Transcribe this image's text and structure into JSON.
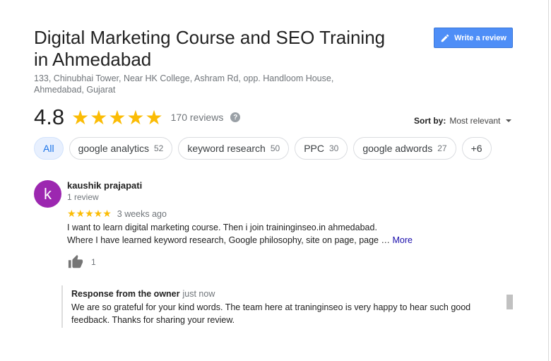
{
  "place": {
    "title": "Digital Marketing Course and SEO Training in Ahmedabad",
    "address": "133, Chinubhai Tower, Near HK College, Ashram Rd, opp. Handloom House, Ahmedabad, Gujarat"
  },
  "actions": {
    "write_review": "Write a review"
  },
  "rating": {
    "value": "4.8",
    "stars": "★★★★★",
    "count_text": "170 reviews",
    "help": "?"
  },
  "sort": {
    "label": "Sort by:",
    "value": "Most relevant"
  },
  "chips": [
    {
      "label": "All",
      "count": ""
    },
    {
      "label": "google analytics",
      "count": "52"
    },
    {
      "label": "keyword research",
      "count": "50"
    },
    {
      "label": "PPC",
      "count": "30"
    },
    {
      "label": "google adwords",
      "count": "27"
    },
    {
      "label": "+6",
      "count": ""
    }
  ],
  "review": {
    "avatar_letter": "k",
    "name": "kaushik prajapati",
    "review_count": "1 review",
    "stars": "★★★★★",
    "time": "3 weeks ago",
    "line1": "I want to learn digital marketing course. Then i join traininginseo.in ahmedabad.",
    "line2": "Where I have learned keyword research, Google philosophy, site on page, page …",
    "more": "More",
    "likes": "1"
  },
  "response": {
    "heading": "Response from the owner",
    "time": "just now",
    "text": "We are so grateful for your kind words. The team here at traninginseo is very happy to hear such good feedback. Thanks for sharing your review."
  },
  "colors": {
    "accent": "#4e8ef7",
    "star": "#fbbc05",
    "avatar": "#9c27b0",
    "link": "#1a0dab"
  },
  "icons": {
    "write": "pencil-icon",
    "help": "help-icon",
    "like": "thumbs-up-icon",
    "sort": "chevron-down-icon"
  }
}
